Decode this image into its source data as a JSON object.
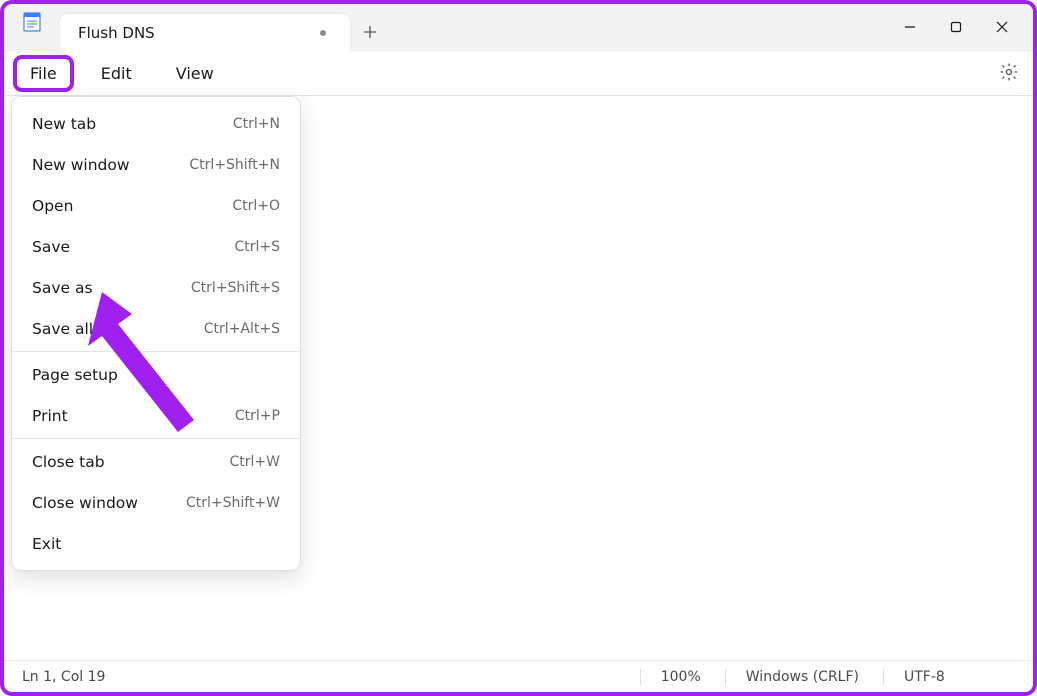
{
  "window": {
    "tab_title": "Flush DNS",
    "modified": true
  },
  "menubar": {
    "items": [
      "File",
      "Edit",
      "View"
    ],
    "active_index": 0
  },
  "file_menu": {
    "groups": [
      [
        {
          "label": "New tab",
          "shortcut": "Ctrl+N"
        },
        {
          "label": "New window",
          "shortcut": "Ctrl+Shift+N"
        },
        {
          "label": "Open",
          "shortcut": "Ctrl+O"
        },
        {
          "label": "Save",
          "shortcut": "Ctrl+S"
        },
        {
          "label": "Save as",
          "shortcut": "Ctrl+Shift+S"
        },
        {
          "label": "Save all",
          "shortcut": "Ctrl+Alt+S"
        }
      ],
      [
        {
          "label": "Page setup",
          "shortcut": ""
        },
        {
          "label": "Print",
          "shortcut": "Ctrl+P"
        }
      ],
      [
        {
          "label": "Close tab",
          "shortcut": "Ctrl+W"
        },
        {
          "label": "Close window",
          "shortcut": "Ctrl+Shift+W"
        },
        {
          "label": "Exit",
          "shortcut": ""
        }
      ]
    ]
  },
  "statusbar": {
    "position": "Ln 1, Col 19",
    "zoom": "100%",
    "line_ending": "Windows (CRLF)",
    "encoding": "UTF-8"
  },
  "annotation": {
    "highlight_color": "#a020f0",
    "arrow_target": "Save as"
  }
}
